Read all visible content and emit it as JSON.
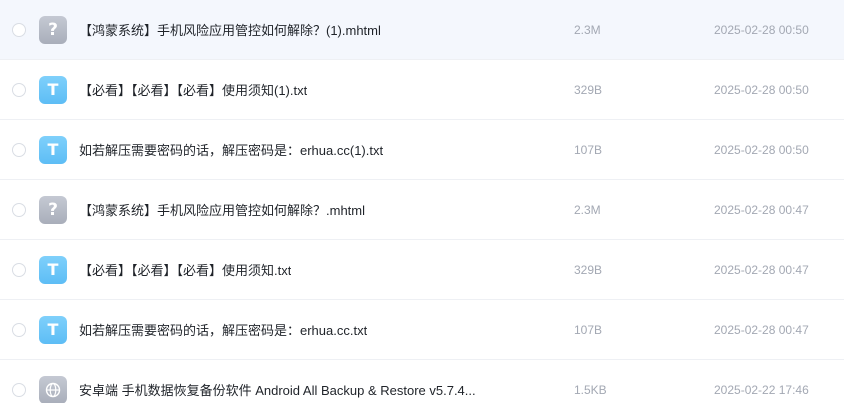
{
  "files": [
    {
      "icon": "unknown-file-icon",
      "glyph": "?",
      "name": "【鸿蒙系统】手机风险应用管控如何解除？(1).mhtml",
      "size": "2.3M",
      "date": "2025-02-28 00:50"
    },
    {
      "icon": "txt-file-icon",
      "glyph": "T",
      "name": "【必看】【必看】【必看】使用须知(1).txt",
      "size": "329B",
      "date": "2025-02-28 00:50"
    },
    {
      "icon": "txt-file-icon",
      "glyph": "T",
      "name": "如若解压需要密码的话，解压密码是：erhua.cc(1).txt",
      "size": "107B",
      "date": "2025-02-28 00:50"
    },
    {
      "icon": "unknown-file-icon",
      "glyph": "?",
      "name": "【鸿蒙系统】手机风险应用管控如何解除？.mhtml",
      "size": "2.3M",
      "date": "2025-02-28 00:47"
    },
    {
      "icon": "txt-file-icon",
      "glyph": "T",
      "name": "【必看】【必看】【必看】使用须知.txt",
      "size": "329B",
      "date": "2025-02-28 00:47"
    },
    {
      "icon": "txt-file-icon",
      "glyph": "T",
      "name": "如若解压需要密码的话，解压密码是：erhua.cc.txt",
      "size": "107B",
      "date": "2025-02-28 00:47"
    },
    {
      "icon": "web-file-icon",
      "glyph": "",
      "name": "安卓端 手机数据恢复备份软件 Android All Backup & Restore v5.7.4...",
      "size": "1.5KB",
      "date": "2025-02-22 17:46"
    }
  ]
}
